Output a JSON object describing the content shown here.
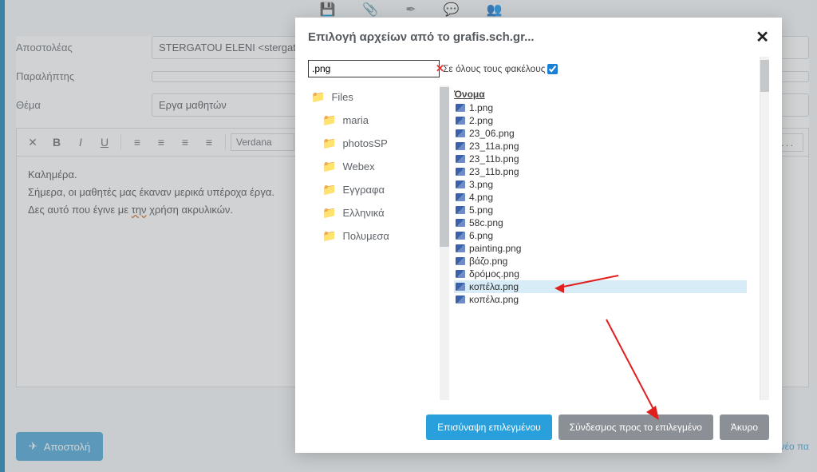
{
  "compose": {
    "sender_label": "Αποστολέας",
    "sender_value": "STERGATOU ELENI <stergatu@",
    "recipient_label": "Παραλήπτης",
    "recipient_value": "",
    "subject_label": "Θέμα",
    "subject_value": "Εργα μαθητών",
    "font_name": "Verdana",
    "body_line1": "Καλημέρα.",
    "body_line2_a": "Σήμερα, οι μαθητές μας έκαναν μερικά υπέροχα έργα.",
    "body_line3_a": "Δες αυτό που έγινε με ",
    "body_line3_word": "την",
    "body_line3_b": " χρήση ακρυλικών.",
    "more": "...",
    "send": "Αποστολή",
    "new_hint": "νέο πα"
  },
  "modal": {
    "title": "Επιλογή αρχείων από το grafis.sch.gr...",
    "search_value": ".png",
    "all_folders_label": "Σε όλους τους φακέλους",
    "all_folders_checked": true,
    "column_name": "Όνομα",
    "root_folder": "Files",
    "folders": [
      "maria",
      "photosSP",
      "Webex",
      "Εγγραφα",
      "Ελληνικά",
      "Πολυμεσα"
    ],
    "files": [
      {
        "name": "1.png",
        "selected": false
      },
      {
        "name": "2.png",
        "selected": false
      },
      {
        "name": "23_06.png",
        "selected": false
      },
      {
        "name": "23_11a.png",
        "selected": false
      },
      {
        "name": "23_11b.png",
        "selected": false
      },
      {
        "name": "23_11b.png",
        "selected": false
      },
      {
        "name": "3.png",
        "selected": false
      },
      {
        "name": "4.png",
        "selected": false
      },
      {
        "name": "5.png",
        "selected": false
      },
      {
        "name": "58c.png",
        "selected": false
      },
      {
        "name": "6.png",
        "selected": false
      },
      {
        "name": "painting.png",
        "selected": false
      },
      {
        "name": "βάζο.png",
        "selected": false
      },
      {
        "name": "δρόμος.png",
        "selected": false
      },
      {
        "name": "κοπέλα.png",
        "selected": true
      },
      {
        "name": "κοπέλα.png",
        "selected": false
      }
    ],
    "btn_attach": "Επισύναψη επιλεγμένου",
    "btn_link": "Σύνδεσμος προς το επιλεγμένο",
    "btn_cancel": "Άκυρο"
  }
}
